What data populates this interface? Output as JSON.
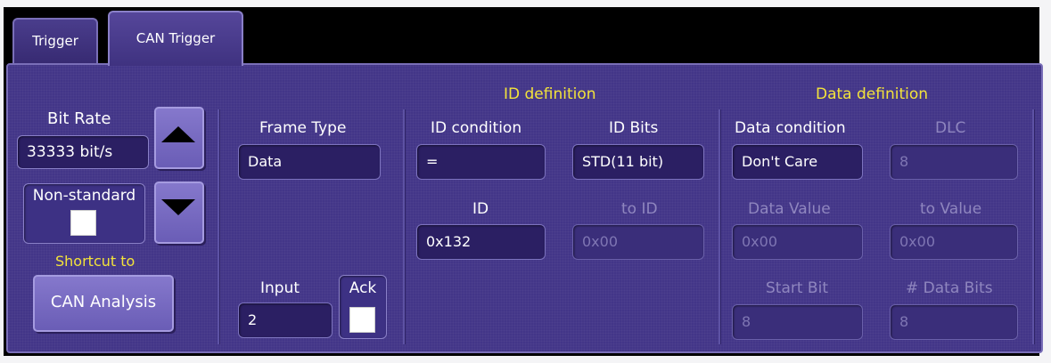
{
  "tabs": [
    {
      "label": "Trigger",
      "active": false
    },
    {
      "label": "CAN Trigger",
      "active": true
    }
  ],
  "bit_rate": {
    "label": "Bit Rate",
    "value": "33333 bit/s"
  },
  "non_standard": {
    "label": "Non-standard",
    "checked": false
  },
  "shortcut": {
    "label": "Shortcut to",
    "button": "CAN Analysis"
  },
  "frame_type": {
    "label": "Frame Type",
    "value": "Data"
  },
  "input": {
    "label": "Input",
    "value": "2"
  },
  "ack": {
    "label": "Ack",
    "checked": false
  },
  "id_definition": {
    "title": "ID definition",
    "condition_label": "ID condition",
    "condition_value": "=",
    "bits_label": "ID Bits",
    "bits_value": "STD(11 bit)",
    "id_label": "ID",
    "id_value": "0x132",
    "to_id_label": "to ID",
    "to_id_value": "0x00"
  },
  "data_definition": {
    "title": "Data definition",
    "condition_label": "Data condition",
    "condition_value": "Don't Care",
    "dlc_label": "DLC",
    "dlc_value": "8",
    "data_value_label": "Data Value",
    "data_value": "0x00",
    "to_value_label": "to Value",
    "to_value": "0x00",
    "start_bit_label": "Start Bit",
    "start_bit_value": "8",
    "num_data_bits_label": "# Data Bits",
    "num_data_bits_value": "8"
  },
  "colors": {
    "panel": "#433688",
    "highlight_text": "#f3e33a",
    "field_bg": "#2b1f63",
    "button": "#7a6dc4"
  }
}
